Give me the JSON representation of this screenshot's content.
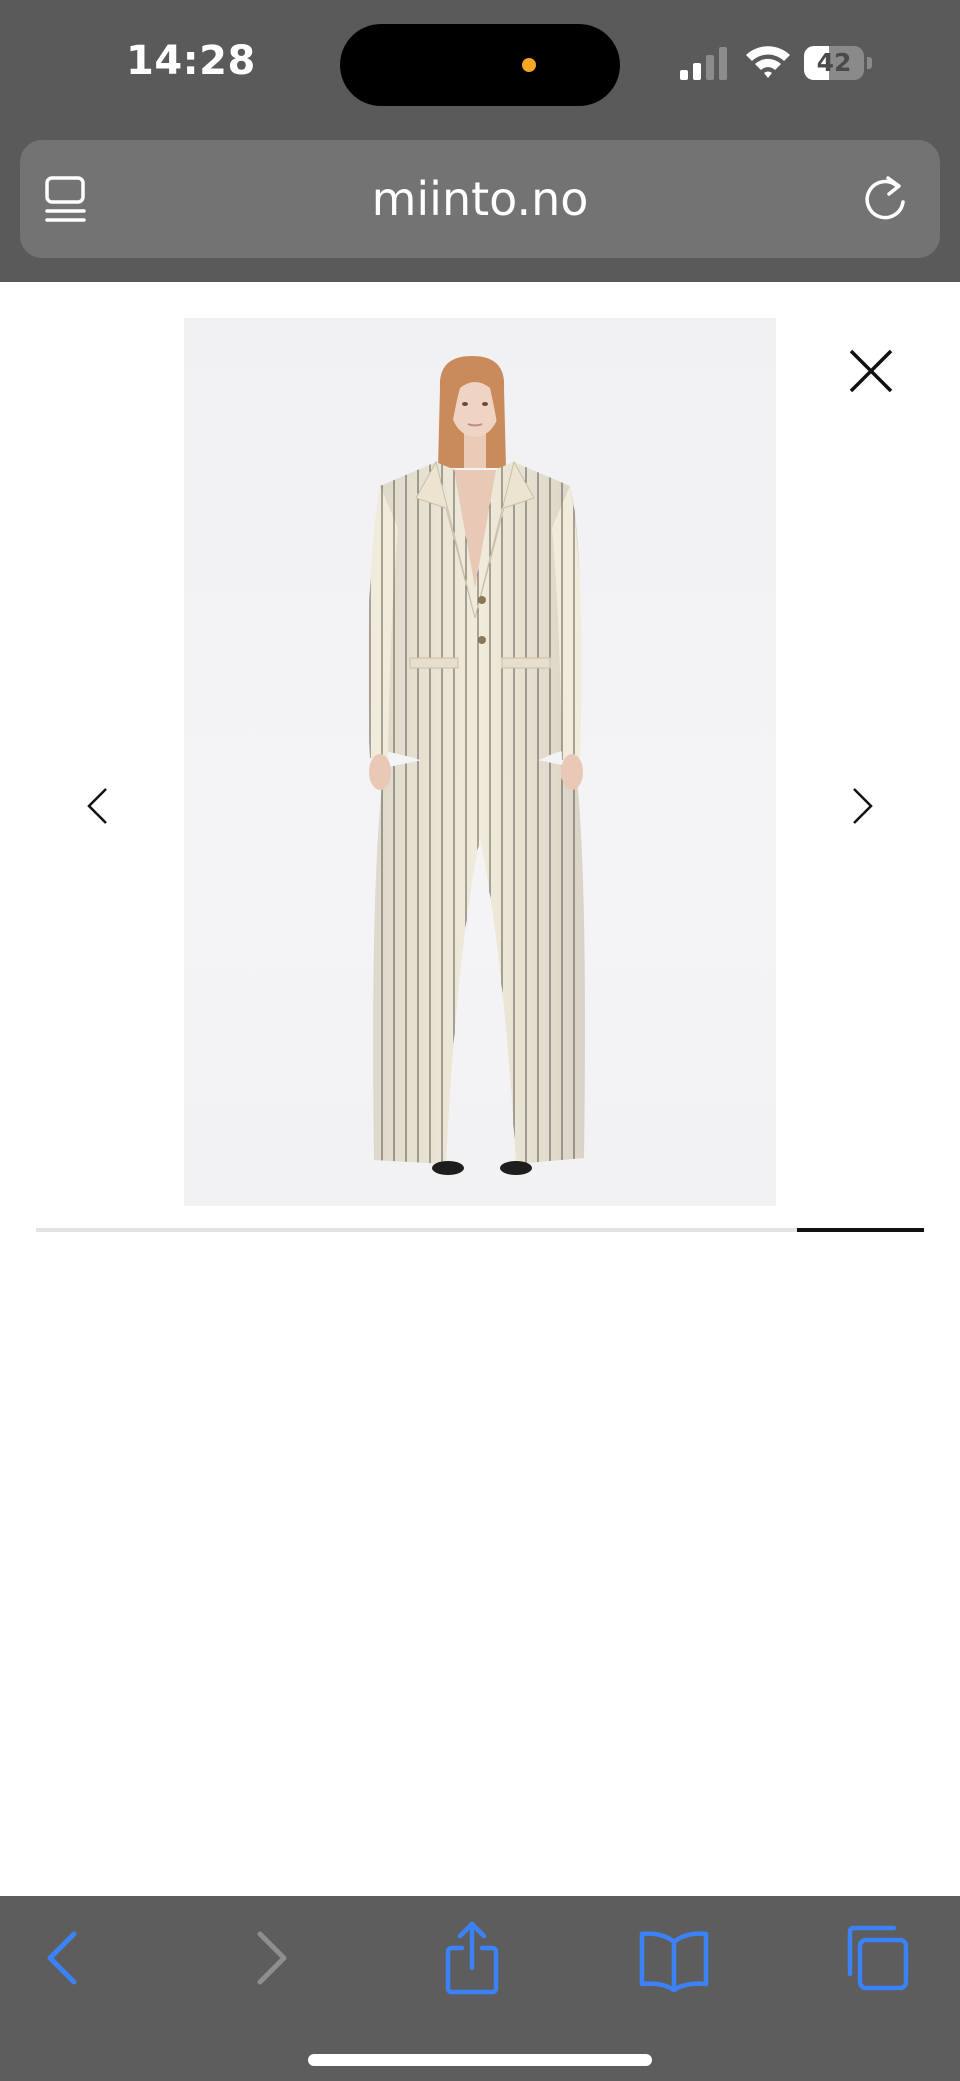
{
  "status_bar": {
    "time": "14:28",
    "battery_level": "42",
    "battery_fraction": 0.42
  },
  "browser": {
    "url": "miinto.no"
  },
  "gallery": {
    "progress_start": 0.857,
    "progress_end": 1.0,
    "accent_color": "#111111"
  },
  "toolbar": {
    "icons": [
      "back-icon",
      "forward-icon",
      "share-icon",
      "bookmarks-icon",
      "tabs-icon"
    ],
    "active_color": "#3b82f6",
    "disabled_color": "#8e8e8e"
  }
}
